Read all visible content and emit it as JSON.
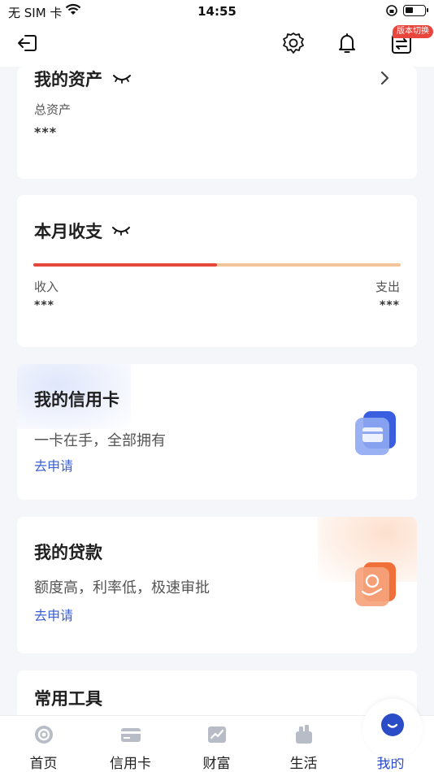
{
  "status_bar": {
    "carrier": "无 SIM 卡",
    "time": "14:55"
  },
  "nav": {
    "switch_badge": "版本切换"
  },
  "assets": {
    "title": "我的资产",
    "label": "总资产",
    "value": "***"
  },
  "monthly": {
    "title": "本月收支",
    "income_label": "收入",
    "expense_label": "支出",
    "income_value": "***",
    "expense_value": "***",
    "income_ratio": 0.5
  },
  "credit_card": {
    "title": "我的信用卡",
    "subtitle": "一卡在手，全部拥有",
    "link": "去申请"
  },
  "loan": {
    "title": "我的贷款",
    "subtitle": "额度高，利率低，极速审批",
    "link": "去申请"
  },
  "tools": {
    "title": "常用工具"
  },
  "tabbar": {
    "tabs": [
      {
        "label": "首页",
        "icon": "home-icon"
      },
      {
        "label": "信用卡",
        "icon": "credit-card-icon"
      },
      {
        "label": "财富",
        "icon": "wealth-icon"
      },
      {
        "label": "生活",
        "icon": "life-icon"
      },
      {
        "label": "我的",
        "icon": "mine-icon",
        "active": true
      }
    ]
  },
  "colors": {
    "accent": "#2b4bd3",
    "income": "#e5483b",
    "expense": "#f3c49a",
    "badge": "#e8453c",
    "link": "#3b5fd6"
  }
}
